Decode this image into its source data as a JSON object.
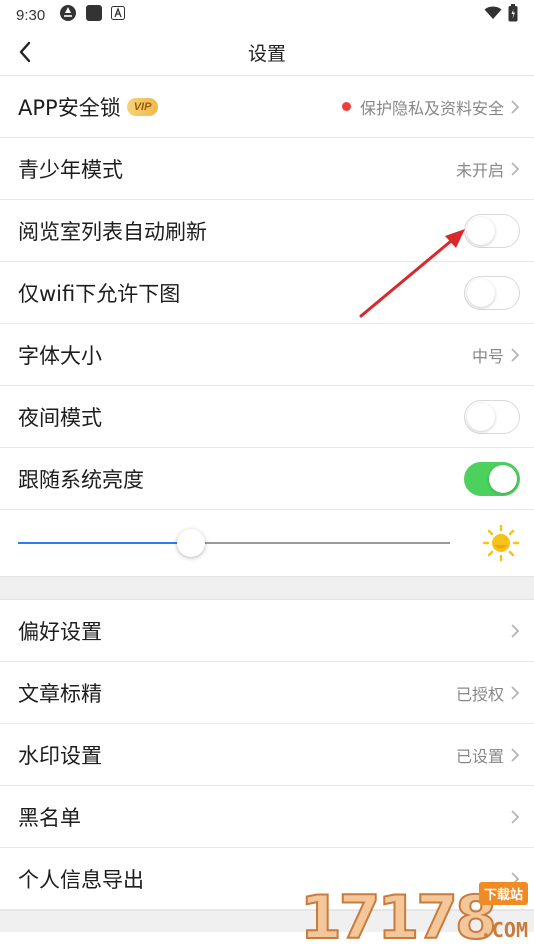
{
  "status_bar": {
    "time": "9:30"
  },
  "header": {
    "title": "设置"
  },
  "rows_group1": [
    {
      "id": "app-lock",
      "label": "APP安全锁",
      "badge": "VIP",
      "value": "保护隐私及资料安全",
      "type": "link"
    },
    {
      "id": "youth-mode",
      "label": "青少年模式",
      "value": "未开启",
      "type": "link"
    },
    {
      "id": "auto-refresh",
      "label": "阅览室列表自动刷新",
      "type": "toggle",
      "on": false
    },
    {
      "id": "wifi-images",
      "label": "仅wifi下允许下图",
      "type": "toggle",
      "on": false
    },
    {
      "id": "font-size",
      "label": "字体大小",
      "value": "中号",
      "type": "link"
    },
    {
      "id": "night-mode",
      "label": "夜间模式",
      "type": "toggle",
      "on": false
    },
    {
      "id": "follow-brightness",
      "label": "跟随系统亮度",
      "type": "toggle",
      "on": true
    }
  ],
  "brightness": {
    "level": 0.4,
    "accent": "#2b7df0"
  },
  "rows_group2": [
    {
      "id": "preferences",
      "label": "偏好设置",
      "value": "",
      "type": "link"
    },
    {
      "id": "article-mark",
      "label": "文章标精",
      "value": "已授权",
      "type": "link"
    },
    {
      "id": "watermark",
      "label": "水印设置",
      "value": "已设置",
      "type": "link"
    },
    {
      "id": "blacklist",
      "label": "黑名单",
      "value": "",
      "type": "link"
    },
    {
      "id": "export-info",
      "label": "个人信息导出",
      "value": "",
      "type": "link"
    }
  ],
  "watermark_logo": {
    "digits": "17178",
    "badge": "下载站",
    "suffix": ".COM"
  },
  "colors": {
    "toggle_on": "#4cd05e",
    "vip": "#eeb94c",
    "dot": "#f23b3b",
    "arrow": "#d9282c"
  }
}
